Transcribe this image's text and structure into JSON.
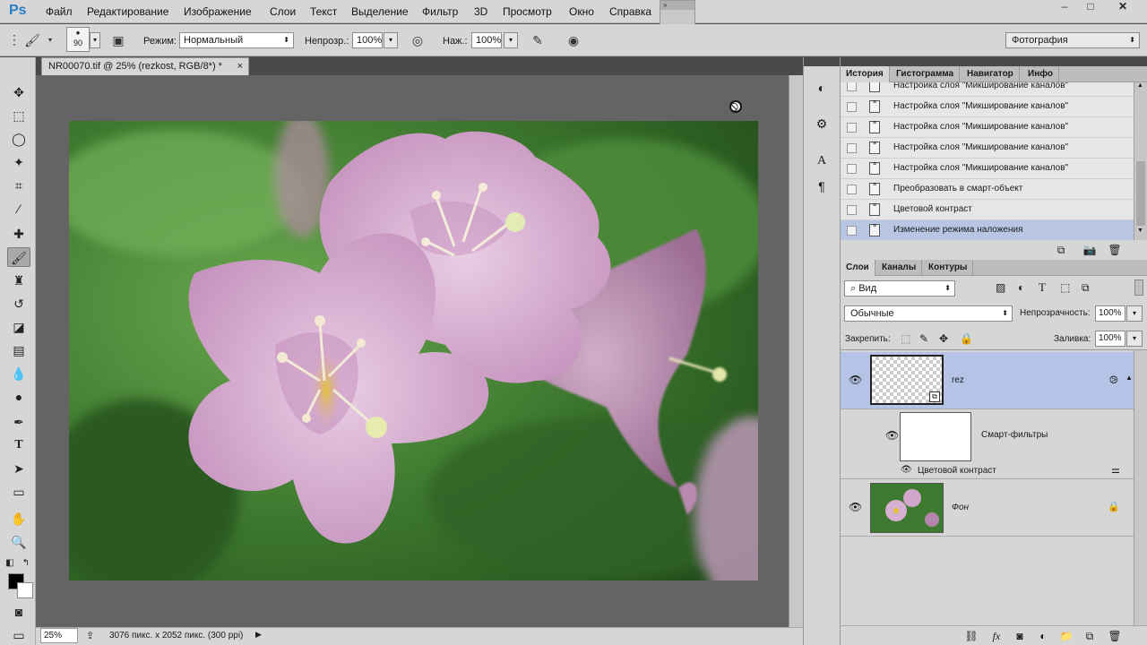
{
  "app": {
    "logo": "Ps"
  },
  "menu": [
    "Файл",
    "Редактирование",
    "Изображение",
    "Слои",
    "Текст",
    "Выделение",
    "Фильтр",
    "3D",
    "Просмотр",
    "Окно",
    "Справка"
  ],
  "options": {
    "brush_size": "90",
    "mode_label": "Режим:",
    "mode_value": "Нормальный",
    "opacity_label": "Непрозр.:",
    "opacity_value": "100%",
    "flow_label": "Наж.:",
    "flow_value": "100%",
    "workspace": "Фотография"
  },
  "document": {
    "tab_title": "NR00070.tif @ 25% (rezkost, RGB/8*) *",
    "zoom": "25%",
    "status": "3076 пикс. x 2052 пикс. (300 ppi)"
  },
  "history_panel": {
    "tabs": [
      "История",
      "Гистограмма",
      "Навигатор",
      "Инфо"
    ],
    "items": [
      "Настройка слоя \"Микширование каналов\"",
      "Настройка слоя \"Микширование каналов\"",
      "Настройка слоя \"Микширование каналов\"",
      "Настройка слоя \"Микширование каналов\"",
      "Настройка слоя \"Микширование каналов\"",
      "Преобразовать в смарт-объект",
      "Цветовой контраст",
      "Изменение режима наложения"
    ],
    "selected_index": 7
  },
  "layers_panel": {
    "tabs": [
      "Слои",
      "Каналы",
      "Контуры"
    ],
    "filter_kind": "Вид",
    "blend_mode": "Обычные",
    "opacity_label": "Непрозрачность:",
    "opacity_value": "100%",
    "lock_label": "Закрепить:",
    "fill_label": "Заливка:",
    "fill_value": "100%",
    "layers": [
      {
        "name": "rez",
        "selected": true
      },
      {
        "name": "Смарт-фильтры"
      },
      {
        "name": "Цветовой контраст"
      },
      {
        "name": "Фон",
        "locked": true
      }
    ]
  },
  "colors": {
    "selection": "#b4c3e6",
    "panel_bg": "#d6d6d6",
    "canvas_bg": "#646464",
    "logo": "#2c7fc9"
  }
}
